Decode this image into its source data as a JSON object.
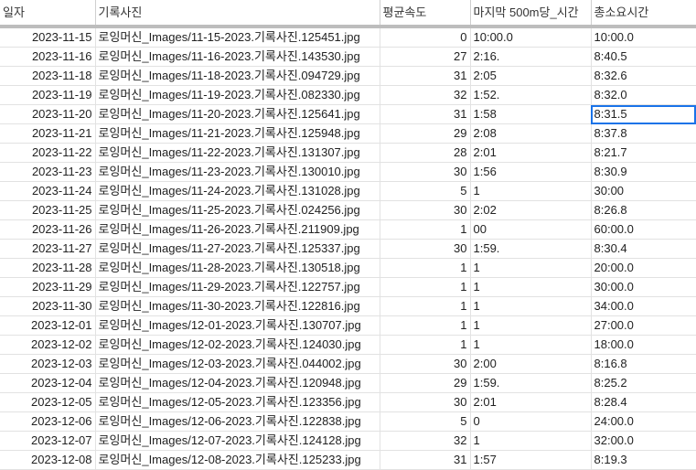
{
  "headers": [
    "일자",
    "기록사진",
    "평균속도",
    "마지막 500m당_시간",
    "총소요시간"
  ],
  "rows": [
    [
      "2023-11-15",
      "로잉머신_Images/11-15-2023.기록사진.125451.jpg",
      "0",
      "10:00.0",
      "10:00.0"
    ],
    [
      "2023-11-16",
      "로잉머신_Images/11-16-2023.기록사진.143530.jpg",
      "27",
      "2:16.",
      "8:40.5"
    ],
    [
      "2023-11-18",
      "로잉머신_Images/11-18-2023.기록사진.094729.jpg",
      "31",
      "2:05",
      "8:32.6"
    ],
    [
      "2023-11-19",
      "로잉머신_Images/11-19-2023.기록사진.082330.jpg",
      "32",
      "1:52.",
      "8:32.0"
    ],
    [
      "2023-11-20",
      "로잉머신_Images/11-20-2023.기록사진.125641.jpg",
      "31",
      "1:58",
      "8:31.5"
    ],
    [
      "2023-11-21",
      "로잉머신_Images/11-21-2023.기록사진.125948.jpg",
      "29",
      "2:08",
      "8:37.8"
    ],
    [
      "2023-11-22",
      "로잉머신_Images/11-22-2023.기록사진.131307.jpg",
      "28",
      "2:01",
      "8:21.7"
    ],
    [
      "2023-11-23",
      "로잉머신_Images/11-23-2023.기록사진.130010.jpg",
      "30",
      "1:56",
      "8:30.9"
    ],
    [
      "2023-11-24",
      "로잉머신_Images/11-24-2023.기록사진.131028.jpg",
      "5",
      "1",
      "30:00"
    ],
    [
      "2023-11-25",
      "로잉머신_Images/11-25-2023.기록사진.024256.jpg",
      "30",
      "2:02",
      "8:26.8"
    ],
    [
      "2023-11-26",
      "로잉머신_Images/11-26-2023.기록사진.211909.jpg",
      "1",
      "00",
      "60:00.0"
    ],
    [
      "2023-11-27",
      "로잉머신_Images/11-27-2023.기록사진.125337.jpg",
      "30",
      "1:59.",
      "8:30.4"
    ],
    [
      "2023-11-28",
      "로잉머신_Images/11-28-2023.기록사진.130518.jpg",
      "1",
      "1",
      "20:00.0"
    ],
    [
      "2023-11-29",
      "로잉머신_Images/11-29-2023.기록사진.122757.jpg",
      "1",
      "1",
      "30:00.0"
    ],
    [
      "2023-11-30",
      "로잉머신_Images/11-30-2023.기록사진.122816.jpg",
      "1",
      "1",
      "34:00.0"
    ],
    [
      "2023-12-01",
      "로잉머신_Images/12-01-2023.기록사진.130707.jpg",
      "1",
      "1",
      "27:00.0"
    ],
    [
      "2023-12-02",
      "로잉머신_Images/12-02-2023.기록사진.124030.jpg",
      "1",
      "1",
      "18:00.0"
    ],
    [
      "2023-12-03",
      "로잉머신_Images/12-03-2023.기록사진.044002.jpg",
      "30",
      "2:00",
      "8:16.8"
    ],
    [
      "2023-12-04",
      "로잉머신_Images/12-04-2023.기록사진.120948.jpg",
      "29",
      "1:59.",
      "8:25.2"
    ],
    [
      "2023-12-05",
      "로잉머신_Images/12-05-2023.기록사진.123356.jpg",
      "30",
      "2:01",
      "8:28.4"
    ],
    [
      "2023-12-06",
      "로잉머신_Images/12-06-2023.기록사진.122838.jpg",
      "5",
      "0",
      "24:00.0"
    ],
    [
      "2023-12-07",
      "로잉머신_Images/12-07-2023.기록사진.124128.jpg",
      "32",
      "1",
      "32:00.0"
    ],
    [
      "2023-12-08",
      "로잉머신_Images/12-08-2023.기록사진.125233.jpg",
      "31",
      "1:57",
      "8:19.3"
    ]
  ],
  "selected": {
    "row": 4,
    "col": 4
  }
}
